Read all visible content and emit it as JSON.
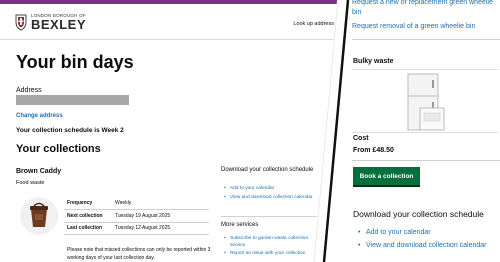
{
  "header": {
    "council_small": "LONDON BOROUGH OF",
    "council_name": "BEXLEY",
    "lookup_link": "Look up address"
  },
  "page": {
    "title": "Your bin days",
    "address_label": "Address",
    "change_address": "Change address",
    "schedule": "Your collection schedule is Week 2",
    "collections_heading": "Your collections"
  },
  "bin": {
    "name": "Brown Caddy",
    "type": "Food waste",
    "details": [
      {
        "key": "Frequency",
        "value": "Weekly"
      },
      {
        "key": "Next collection",
        "value": "Tuesday 19 August 2025"
      },
      {
        "key": "Last collection",
        "value": "Tuesday 12 August 2025"
      }
    ],
    "note": "Please note that missed collections can only be reported within 3 working days of your last collection day."
  },
  "sidebar": {
    "download_heading": "Download your collection schedule",
    "download_links": [
      "Add to your calendar",
      "View and download collection calendar"
    ],
    "more_heading": "More services",
    "more_links": [
      "Subscribe to garden waste collection service",
      "Report an issue with your collection"
    ]
  },
  "right": {
    "links": [
      "Request a new or replacement green wheelie bin",
      "Request removal of a green wheelie bin"
    ],
    "bulky_title": "Bulky waste",
    "cost_label": "Cost",
    "cost_value": "From £48.50",
    "book_button": "Book a collection",
    "download_heading": "Download your collection schedule",
    "download_links": [
      "Add to your calendar",
      "View and download collection calendar"
    ]
  },
  "colors": {
    "brand_purple": "#7b2e8b",
    "link_blue": "#1d70b8",
    "button_green": "#00703c"
  }
}
